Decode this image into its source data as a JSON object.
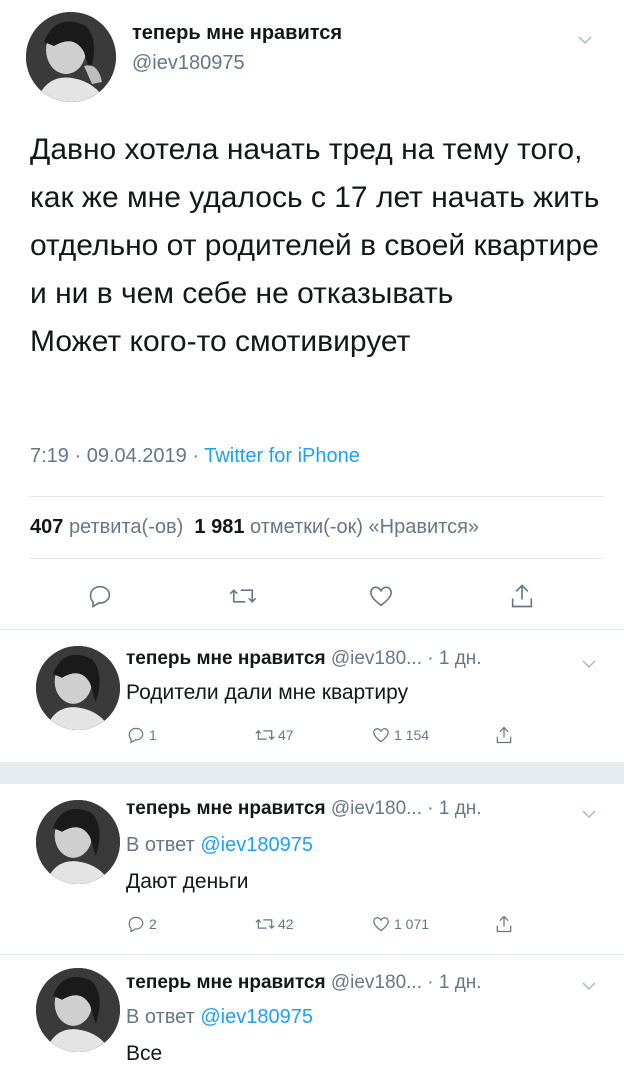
{
  "main_tweet": {
    "display_name": "теперь мне нравится",
    "handle": "@iev180975",
    "text_lines": [
      "Давно хотела начать тред на тему того, как же мне удалось с 17 лет начать жить отдельно от родителей в своей квартире и ни в чем себе не отказывать",
      "Может кого-то смотивирует"
    ],
    "time": "7:19 · 09.04.2019 · ",
    "source": "Twitter for iPhone",
    "retweets_count": "407",
    "retweets_label": "ретвита(-ов)",
    "likes_count": "1 981",
    "likes_label": "отметки(-ок) «Нравится»"
  },
  "replies": [
    {
      "display_name": "теперь мне нравится",
      "handle_time": "@iev180... · 1 дн.",
      "reply_to_prefix": "",
      "reply_to_handle": "",
      "text": "Родители дали мне квартиру",
      "replies": "1",
      "retweets": "47",
      "likes": "1 154"
    },
    {
      "display_name": "теперь мне нравится",
      "handle_time": "@iev180... · 1 дн.",
      "reply_to_prefix": "В ответ",
      "reply_to_handle": "@iev180975",
      "text": "Дают деньги",
      "replies": "2",
      "retweets": "42",
      "likes": "1 071"
    },
    {
      "display_name": "теперь мне нравится",
      "handle_time": "@iev180... · 1 дн.",
      "reply_to_prefix": "В ответ",
      "reply_to_handle": "@iev180975",
      "text": "Все"
    }
  ],
  "icons": {
    "reply": "reply-icon",
    "retweet": "retweet-icon",
    "like": "heart-icon",
    "share": "share-icon",
    "more": "chevron-down-icon"
  },
  "colors": {
    "accent": "#1da1f2",
    "muted": "#657786",
    "text": "#14171a",
    "divider": "#e1e8ed",
    "section_gap": "#e6ecf0"
  }
}
